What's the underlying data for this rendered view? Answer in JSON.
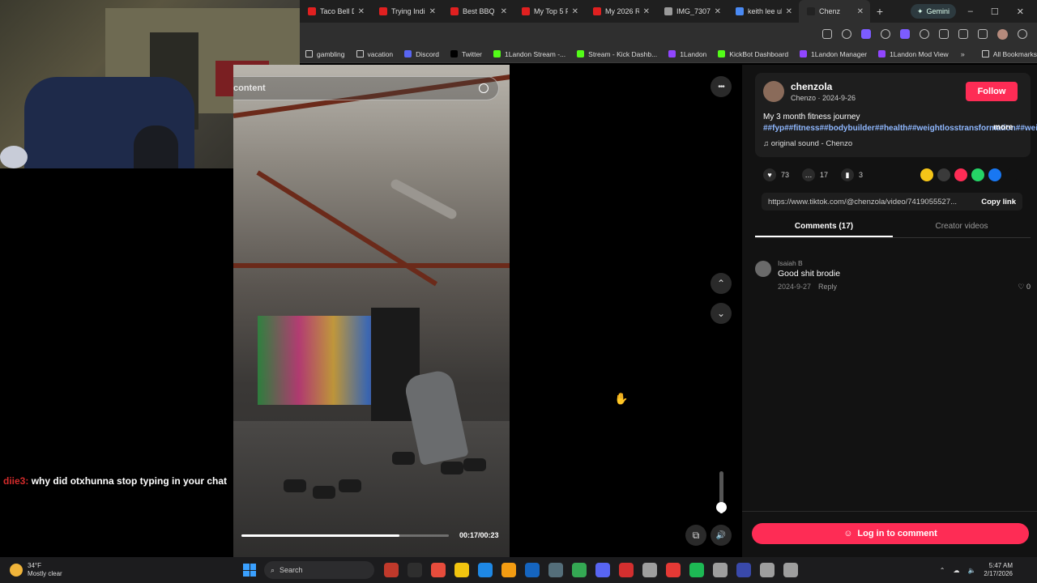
{
  "browser": {
    "tabs": [
      {
        "label": "Taco Bell D",
        "color": "#e02020"
      },
      {
        "label": "Trying Indi",
        "color": "#e02020"
      },
      {
        "label": "Best BBQ i",
        "color": "#e02020"
      },
      {
        "label": "My Top 5 F",
        "color": "#e02020"
      },
      {
        "label": "My 2026 R",
        "color": "#e02020"
      },
      {
        "label": "IMG_7307.",
        "color": "#9a9a9a"
      },
      {
        "label": "keith lee ul",
        "color": "#4a8af4"
      },
      {
        "label": "Chenz",
        "color": "#222222",
        "active": true
      }
    ],
    "new_tab": "+",
    "gemini_label": "Gemini",
    "window_controls": [
      "–",
      "☐",
      "✕"
    ],
    "bookmarks": [
      {
        "label": "gambling",
        "folder": true,
        "color": "#cccccc"
      },
      {
        "label": "vacation",
        "folder": true,
        "color": "#cccccc"
      },
      {
        "label": "Discord",
        "color": "#5865f2"
      },
      {
        "label": "Twitter",
        "color": "#000000"
      },
      {
        "label": "1Landon Stream -...",
        "color": "#53fc18"
      },
      {
        "label": "Stream - Kick Dashb...",
        "color": "#53fc18"
      },
      {
        "label": "1Landon",
        "color": "#9146ff"
      },
      {
        "label": "KickBot Dashboard",
        "color": "#53fc18"
      },
      {
        "label": "1Landon Manager",
        "color": "#9146ff"
      },
      {
        "label": "1Landon Mod View",
        "color": "#9146ff"
      }
    ],
    "bookmarks_more": "»",
    "all_bookmarks": "All Bookmarks"
  },
  "chat": {
    "user": "diie3:",
    "message": "why did otxhunna stop typing in your chat",
    "user_color": "#d42b2b"
  },
  "video": {
    "ghost_search_text": "content",
    "progress_fraction": 0.76,
    "timecode": "00:17/00:23"
  },
  "player_controls": {
    "more": "•••",
    "prev": "⌃",
    "next": "⌄",
    "volume_fraction": 0.2,
    "volume_icon": "🔊",
    "miniplayer_icon": "⧉"
  },
  "post": {
    "username": "chenzola",
    "meta": "Chenzo · 2024-9-26",
    "follow_label": "Follow",
    "desc_text": "My 3 month fitness journey ",
    "desc_tags": "##fyp##fitness##bodybuilder##health##weightlosstransformation##weightloss#...",
    "more_label": "more",
    "sound": "♫  original sound - Chenzo",
    "likes": "73",
    "comments": "17",
    "saves": "3",
    "share_colors": [
      "#f5c518",
      "#3a3a3a",
      "#fe2c55",
      "#25d366",
      "#1877f2",
      "#121212"
    ],
    "url": "https://www.tiktok.com/@chenzola/video/7419055527...",
    "copy_label": "Copy link",
    "tab_comments": "Comments (17)",
    "tab_creator": "Creator videos"
  },
  "comment": {
    "name": "Isaiah B",
    "text": "Good shit brodie",
    "date": "2024-9-27",
    "reply": "Reply",
    "likes": "♡ 0"
  },
  "login_label": "Log in to comment",
  "taskbar": {
    "temp": "34°F",
    "weather": "Mostly clear",
    "search": "Search",
    "app_colors": [
      "#c0392b",
      "#2e2e2e",
      "#e74c3c",
      "#f1c40f",
      "#1e88e5",
      "#f39c12",
      "#1565c0",
      "#546e7a",
      "#34a853",
      "#5865f2",
      "#d32f2f",
      "#9e9e9e",
      "#e53935",
      "#1db954",
      "#9e9e9e",
      "#3949ab",
      "#9e9e9e",
      "#9e9e9e"
    ],
    "time": "5:47 AM",
    "date": "2/17/2026"
  }
}
